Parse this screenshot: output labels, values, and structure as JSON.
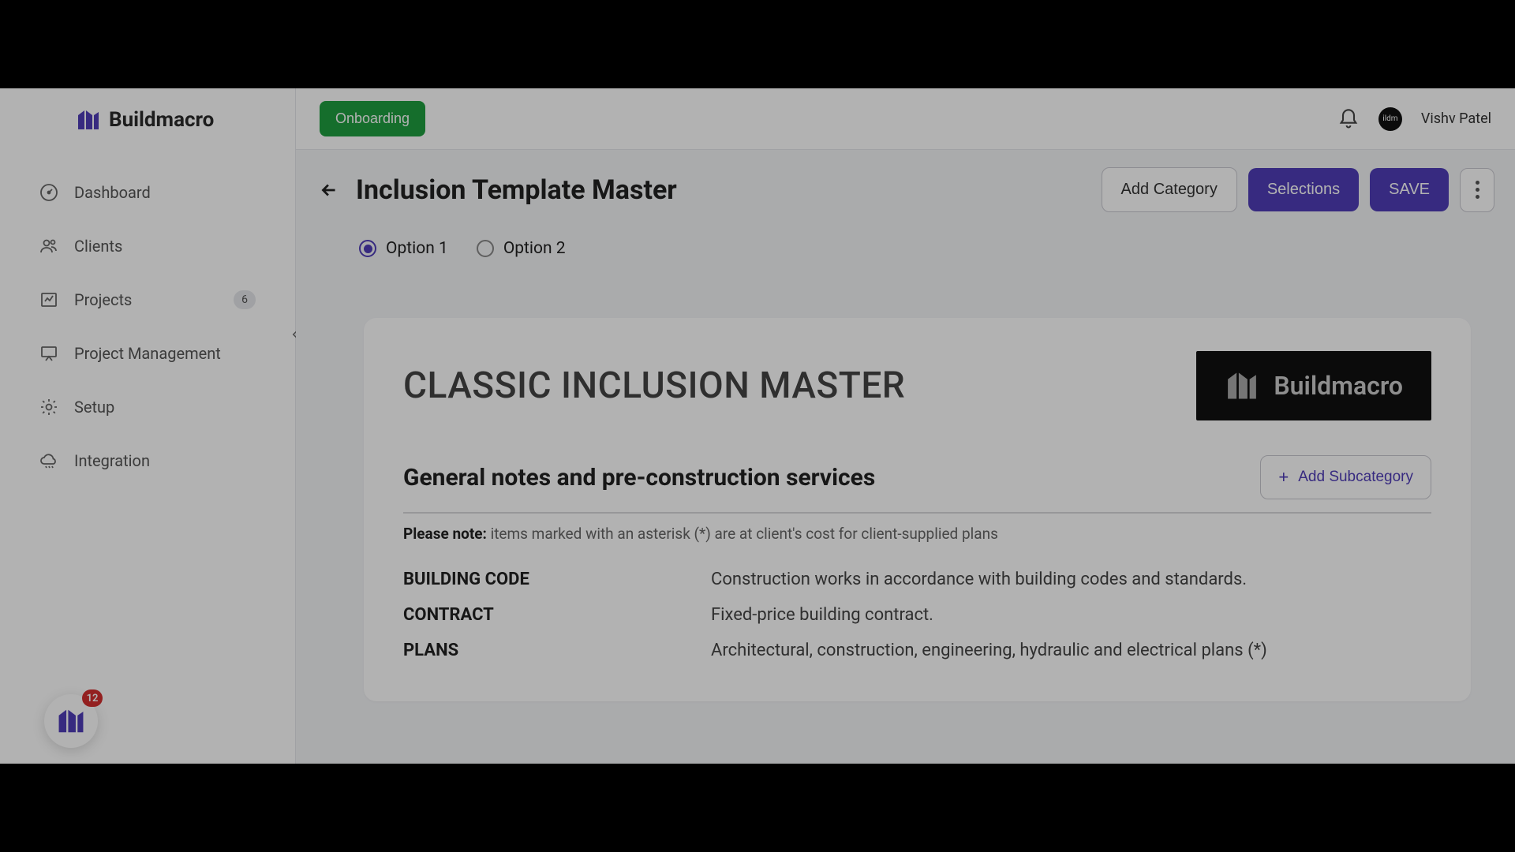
{
  "brand_name": "Buildmacro",
  "header": {
    "onboarding_label": "Onboarding",
    "user_name": "Vishv Patel",
    "avatar_text": "ildm"
  },
  "sidebar": {
    "items": [
      {
        "label": "Dashboard"
      },
      {
        "label": "Clients"
      },
      {
        "label": "Projects",
        "badge": "6"
      },
      {
        "label": "Project Management"
      },
      {
        "label": "Setup"
      },
      {
        "label": "Integration"
      }
    ],
    "notification_count": "12"
  },
  "page": {
    "title": "Inclusion Template Master",
    "actions": {
      "add_category": "Add Category",
      "selections": "Selections",
      "save": "SAVE"
    },
    "options": [
      {
        "label": "Option 1",
        "selected": true
      },
      {
        "label": "Option 2",
        "selected": false
      }
    ]
  },
  "card": {
    "label": "CLASSIC INCLUSION MASTER",
    "brand_text": "Buildmacro",
    "section_title": "General notes and pre-construction services",
    "add_subcategory": "Add Subcategory",
    "note_prefix": "Please note:",
    "note_text": " items marked with an asterisk (*) are at client's cost for client-supplied plans",
    "items": [
      {
        "key": "BUILDING CODE",
        "val": "Construction works in accordance with building codes and standards."
      },
      {
        "key": "CONTRACT",
        "val": "Fixed-price building contract."
      },
      {
        "key": "PLANS",
        "val": "Architectural, construction, engineering, hydraulic and electrical plans (*)"
      }
    ]
  }
}
